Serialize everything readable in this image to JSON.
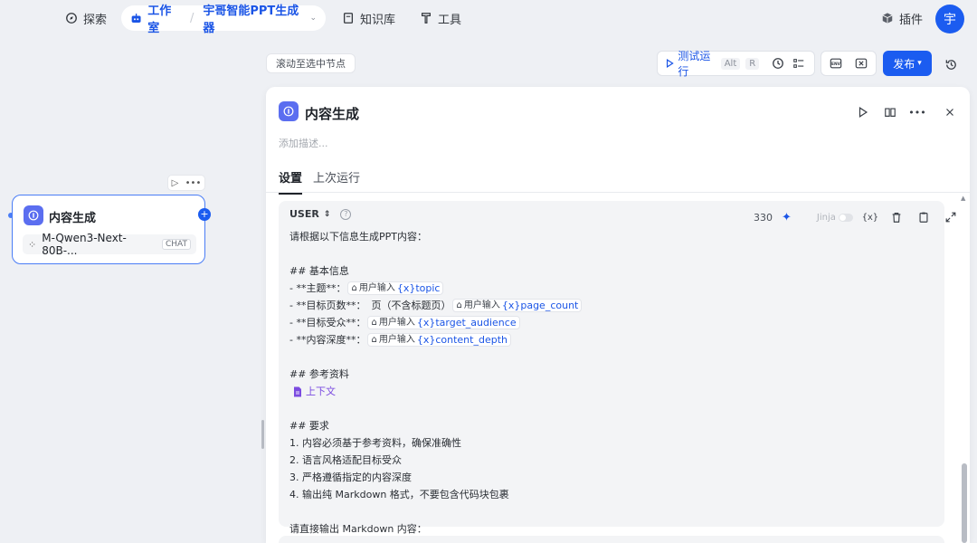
{
  "nav": {
    "explore": "探索",
    "workspace": "工作室",
    "app_name": "宇哥智能PPT生成器",
    "knowledge": "知识库",
    "tools": "工具",
    "plugins": "插件",
    "avatar_letter": "宇"
  },
  "toolbar": {
    "scroll_to_node": "滚动至选中节点",
    "test_run": "测试运行",
    "shortcut_alt": "Alt",
    "shortcut_r": "R",
    "env_label": "ENV",
    "publish": "发布"
  },
  "node": {
    "title": "内容生成",
    "model": "M-Qwen3-Next-80B-...",
    "model_tag": "CHAT"
  },
  "panel": {
    "title": "内容生成",
    "description_placeholder": "添加描述...",
    "tabs": [
      "设置",
      "上次运行"
    ],
    "role": "USER",
    "token_count": "330",
    "jinja_label": "Jinja",
    "var_icon": "{x}",
    "prompt": {
      "l1": "请根据以下信息生成PPT内容：",
      "l3": "## 基本信息",
      "l4_prefix": "- **主题**：",
      "l5_prefix": "- **目标页数**：",
      "l5_mid": "页（不含标题页）",
      "l6_prefix": "- **目标受众**：",
      "l7_prefix": "- **内容深度**：",
      "chip_source": "用户输入",
      "var_topic": "topic",
      "var_page_count": "page_count",
      "var_target_audience": "target_audience",
      "var_content_depth": "content_depth",
      "var_prefix": "{x}",
      "l9": "## 参考资料",
      "context": "上下文",
      "l12": "## 要求",
      "l13": "1. 内容必须基于参考资料，确保准确性",
      "l14": "2. 语言风格适配目标受众",
      "l15": "3. 严格遵循指定的内容深度",
      "l16": "4. 输出纯 Markdown 格式，不要包含代码块包裹",
      "l18": "请直接输出 Markdown 内容："
    }
  },
  "colors": {
    "accent": "#1b5cf0",
    "node_icon": "#5b6ef0",
    "context": "#7b4be0"
  }
}
